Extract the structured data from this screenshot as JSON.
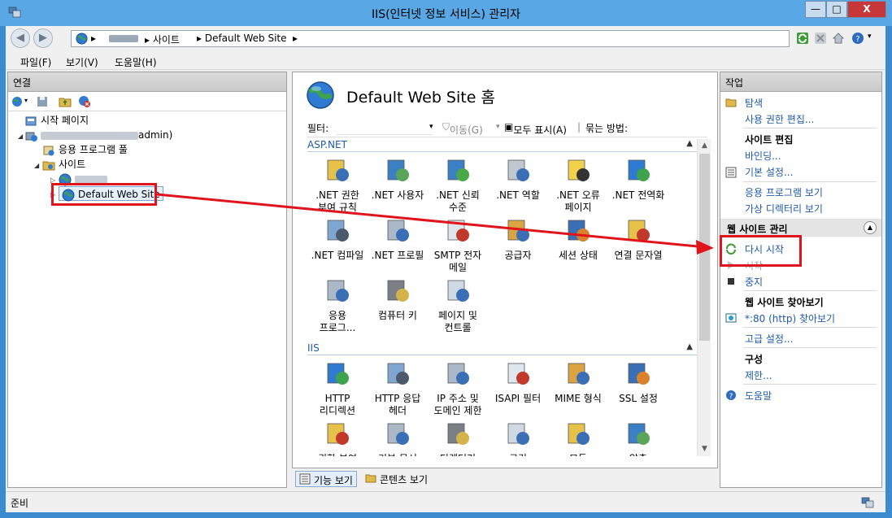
{
  "window": {
    "title": "IIS(인터넷 정보 서비스) 관리자",
    "buttons": {
      "minimize": "—",
      "maximize": "□",
      "close": "X"
    }
  },
  "address_bar": {
    "segments": [
      "▸",
      "▸ 사이트",
      "▸ Default Web Site",
      "▸"
    ]
  },
  "menu": {
    "items": [
      "파일(F)",
      "보기(V)",
      "도움말(H)"
    ]
  },
  "connections": {
    "header": "연결",
    "tree": {
      "start_page": "시작 페이지",
      "server_suffix": "admin)",
      "app_pools": "응용 프로그램 풀",
      "sites": "사이트",
      "default_site": "Default Web Site"
    }
  },
  "center": {
    "title": "Default Web Site 홈",
    "filter": {
      "label": "필터:",
      "go": "이동(G)",
      "show_all": "모두 표시(A)",
      "group_by": "묶는 방법:"
    },
    "groups": [
      {
        "name": "ASP.NET",
        "features": [
          [
            ".NET 권한",
            "부여 규칙"
          ],
          [
            ".NET 사용자"
          ],
          [
            ".NET 신뢰",
            "수준"
          ],
          [
            ".NET 역할"
          ],
          [
            ".NET 오류",
            "페이지"
          ],
          [
            ".NET 전역화"
          ],
          [
            ".NET 컴파일"
          ],
          [
            ".NET 프로필"
          ],
          [
            "SMTP 전자",
            "메일"
          ],
          [
            "공급자"
          ],
          [
            "세션 상태"
          ],
          [
            "연결 문자열"
          ],
          [
            "응용",
            "프로그..."
          ],
          [
            "컴퓨터 키"
          ],
          [
            "페이지 및",
            "컨트롤"
          ]
        ]
      },
      {
        "name": "IIS",
        "features": [
          [
            "HTTP",
            "리디렉션"
          ],
          [
            "HTTP 응답",
            "헤더"
          ],
          [
            "IP 주소 및",
            "도메인 제한"
          ],
          [
            "ISAPI 필터"
          ],
          [
            "MIME 형식"
          ],
          [
            "SSL 설정"
          ],
          [
            "권한 부여"
          ],
          [
            "기본 문서"
          ],
          [
            "디렉터리"
          ],
          [
            "로깅"
          ],
          [
            "모듈"
          ],
          [
            "압축"
          ]
        ]
      }
    ],
    "views": {
      "features": "기능 보기",
      "content": "콘텐츠 보기"
    }
  },
  "actions": {
    "header": "작업",
    "explore": "탐색",
    "edit_permissions": "사용 권한 편집...",
    "edit_site": "사이트 편집",
    "bindings": "바인딩...",
    "basic_settings": "기본 설정...",
    "view_apps": "응용 프로그램 보기",
    "view_vdirs": "가상 디렉터리 보기",
    "manage_site": "웹 사이트 관리",
    "restart": "다시 시작",
    "start": "시작",
    "stop": "중지",
    "browse_site": "웹 사이트 찾아보기",
    "browse_link": "*:80 (http) 찾아보기",
    "advanced": "고급 설정...",
    "config": "구성",
    "limits": "제한...",
    "help": "도움말"
  },
  "status": {
    "text": "준비"
  },
  "colors": {
    "title_bar": "#5aa7e6",
    "link": "#1f5aa6",
    "annotation_red": "#e0141c"
  }
}
